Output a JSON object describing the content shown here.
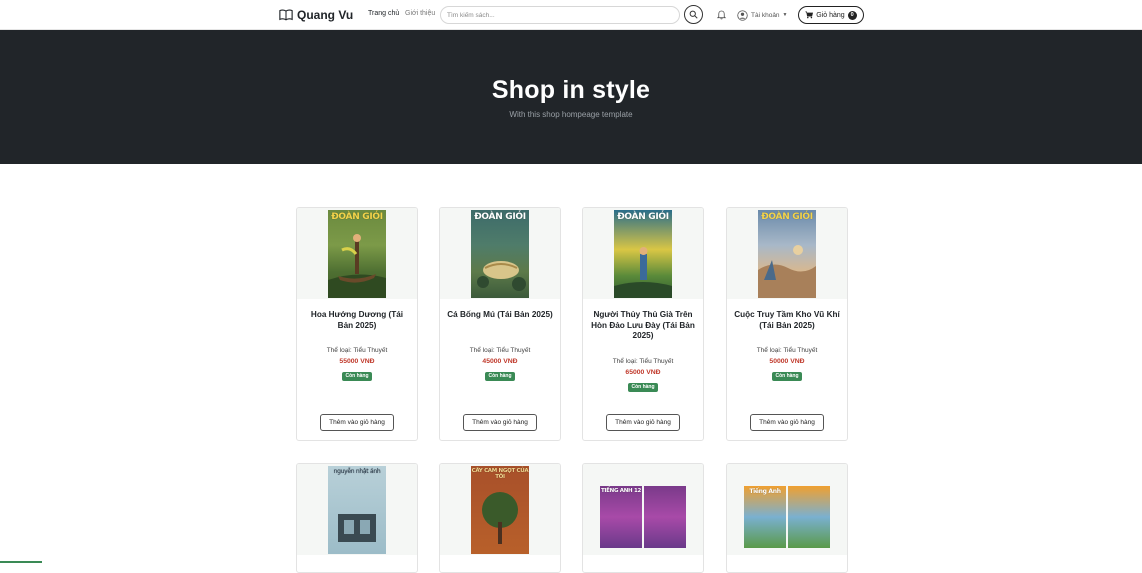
{
  "navbar": {
    "brand": "Quang Vu",
    "links": [
      "Trang chủ",
      "Giới thiệu"
    ],
    "search_placeholder": "Tìm kiếm sách...",
    "account_label": "Tài khoản",
    "cart_label": "Giỏ hàng",
    "cart_count": "0"
  },
  "hero": {
    "title": "Shop in style",
    "subtitle": "With this shop hompeage template"
  },
  "products": [
    {
      "name": "Hoa Hướng Dương (Tái Bản 2025)",
      "category": "Thể loại: Tiểu Thuyết",
      "price": "55000 VNĐ",
      "stock": "Còn hàng",
      "button": "Thêm vào giỏ hàng",
      "cover_masthead": "ĐOÀN GIỎI"
    },
    {
      "name": "Cá Bống Mú (Tái Bản 2025)",
      "category": "Thể loại: Tiểu Thuyết",
      "price": "45000 VNĐ",
      "stock": "Còn hàng",
      "button": "Thêm vào giỏ hàng",
      "cover_masthead": "ĐOÀN GIỎI"
    },
    {
      "name": "Người Thủy Thủ Già Trên Hòn Đảo Lưu Đày (Tái Bản 2025)",
      "category": "Thể loại: Tiểu Thuyết",
      "price": "65000 VNĐ",
      "stock": "Còn hàng",
      "button": "Thêm vào giỏ hàng",
      "cover_masthead": "ĐOÀN GIỎI"
    },
    {
      "name": "Cuộc Truy Tầm Kho Vũ Khí (Tái Bản 2025)",
      "category": "Thể loại: Tiểu Thuyết",
      "price": "50000 VNĐ",
      "stock": "Còn hàng",
      "button": "Thêm vào giỏ hàng",
      "cover_masthead": "ĐOÀN GIỎI"
    }
  ],
  "products_row2": [
    {
      "cover_masthead": "nguyễn nhật ánh"
    },
    {
      "cover_masthead": "CÂY CAM NGỌT CỦA TÔI"
    },
    {
      "cover_masthead": "TIẾNG ANH 12"
    },
    {
      "cover_masthead": "Tiếng Anh"
    }
  ],
  "colors": {
    "hero_bg": "#212529",
    "price": "#c0392b",
    "stock_badge": "#3a8a55"
  }
}
